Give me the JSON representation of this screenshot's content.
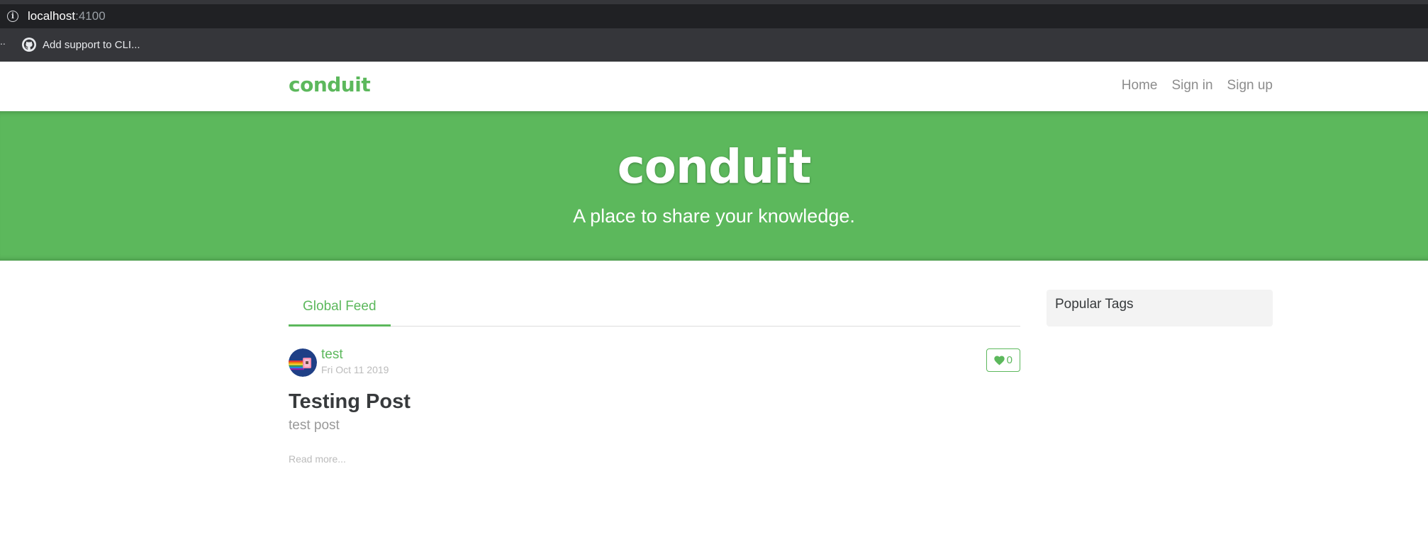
{
  "browser": {
    "url_host": "localhost",
    "url_port": ":4100",
    "bookmark_dots": "..",
    "bookmark_label": "Add support to CLI..."
  },
  "navbar": {
    "brand": "conduit",
    "links": [
      "Home",
      "Sign in",
      "Sign up"
    ]
  },
  "banner": {
    "title": "conduit",
    "subtitle": "A place to share your knowledge."
  },
  "feed": {
    "tab_label": "Global Feed",
    "articles": [
      {
        "author": "test",
        "date": "Fri Oct 11 2019",
        "favorites": "0",
        "title": "Testing Post",
        "description": "test post",
        "read_more": "Read more..."
      }
    ]
  },
  "sidebar": {
    "title": "Popular Tags"
  },
  "colors": {
    "brand_green": "#5cb85c",
    "chrome_dark": "#35363a"
  }
}
